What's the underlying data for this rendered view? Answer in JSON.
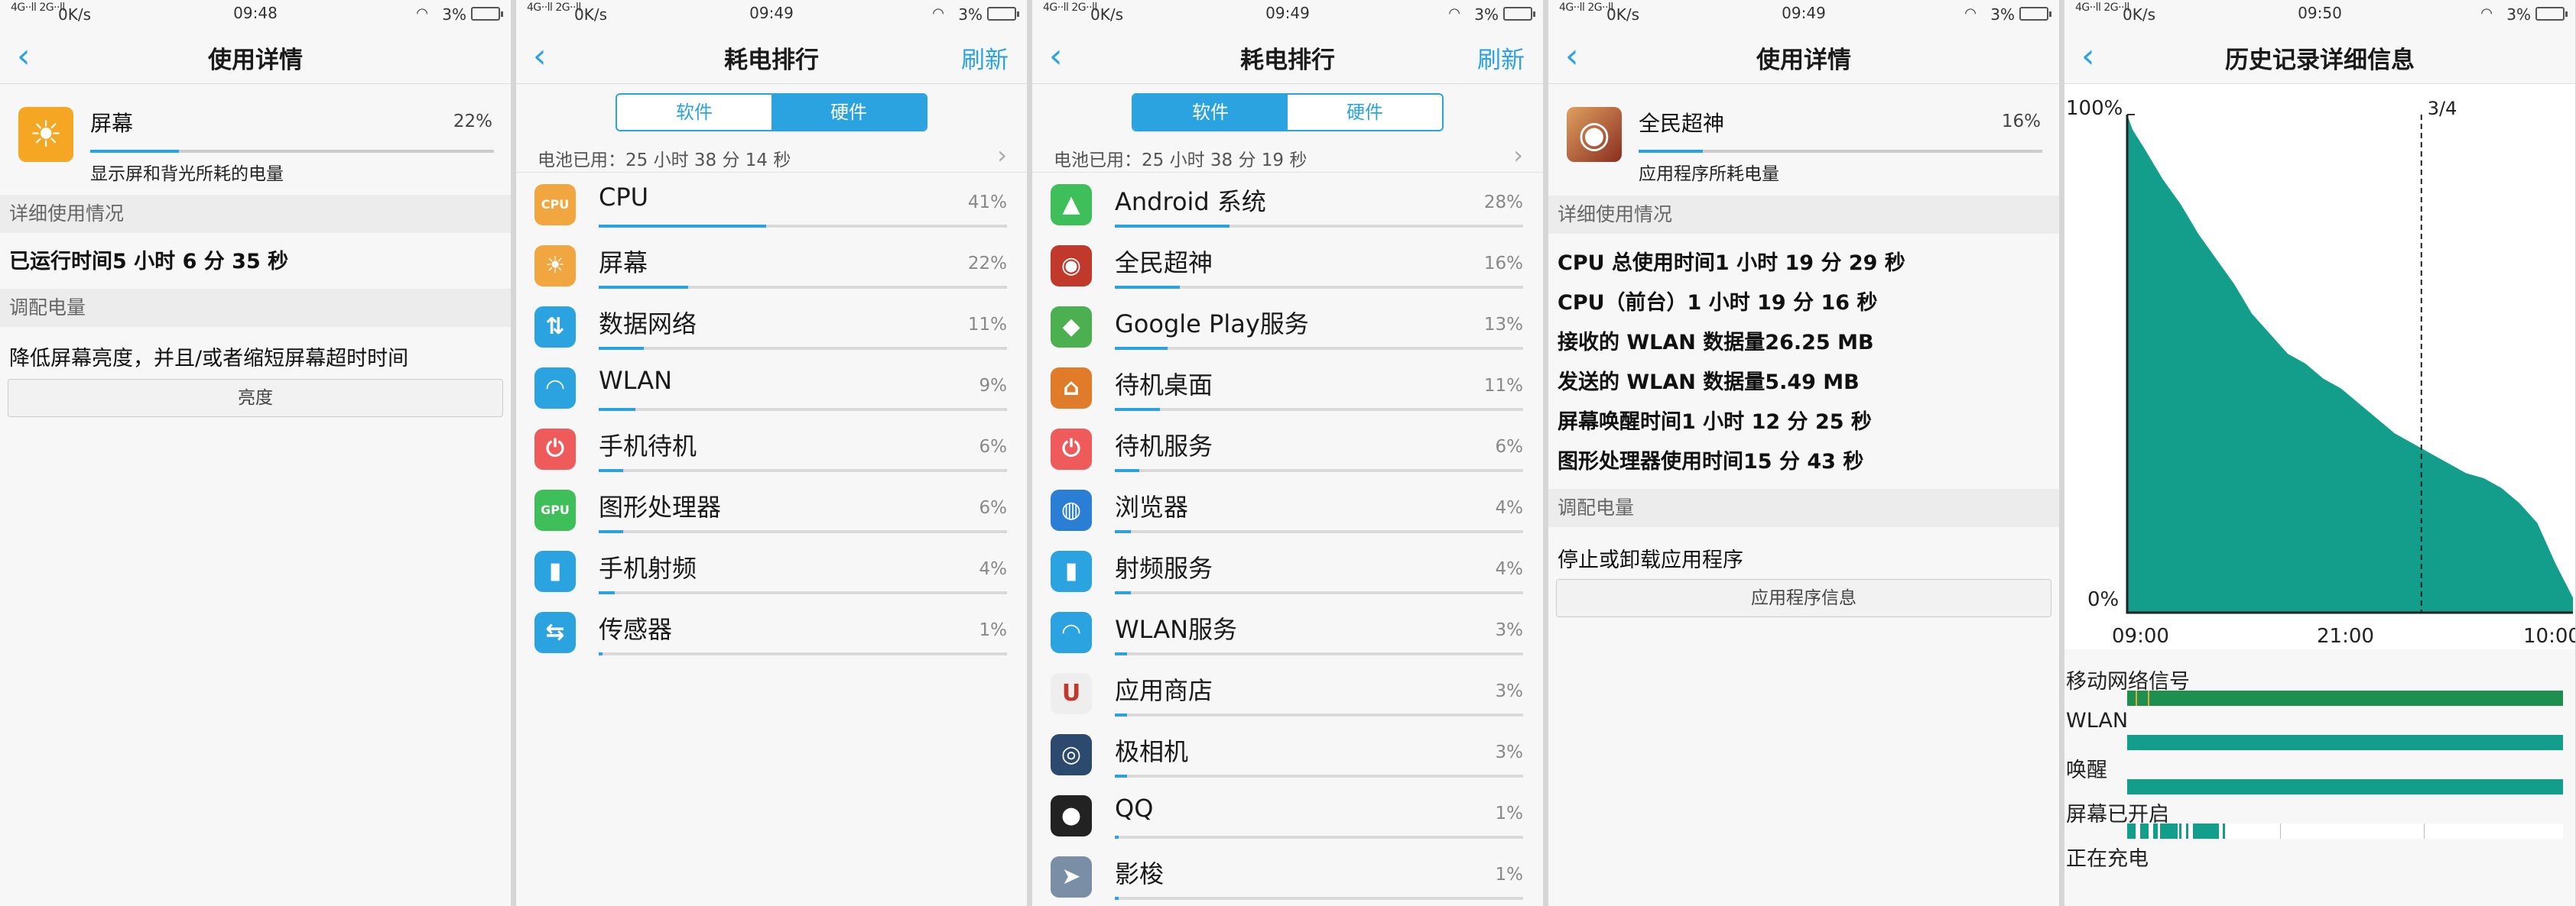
{
  "status": {
    "signal": "4G··ll 2G··ll",
    "speed": "0K/s",
    "wifi_icon": "wifi-icon",
    "battery_pct": "3%",
    "times": [
      "09:48",
      "09:49",
      "09:49",
      "09:49",
      "09:50"
    ]
  },
  "colors": {
    "accent": "#2aa3e0",
    "chart_fill": "#129e8a",
    "charge_orange": "#f2a640"
  },
  "screen1": {
    "title": "使用详情",
    "item_name": "屏幕",
    "item_pct": "22%",
    "item_fraction": 0.22,
    "item_sub": "显示屏和背光所耗的电量",
    "sec_detail": "详细使用情况",
    "runtime": "已运行时间5 小时 6 分 35 秒",
    "sec_adjust": "调配电量",
    "tip": "降低屏幕亮度，并且/或者缩短屏幕超时时间",
    "button": "亮度"
  },
  "screen2": {
    "title": "耗电排行",
    "refresh": "刷新",
    "tab_software": "软件",
    "tab_hardware": "硬件",
    "battery_used": "电池已用：25 小时 38 分 14 秒",
    "rows": [
      {
        "label": "CPU",
        "pct": "41%",
        "value": 41,
        "icon": "cpu-icon",
        "glyph": "CPU",
        "color": "#f2a640"
      },
      {
        "label": "屏幕",
        "pct": "22%",
        "value": 22,
        "icon": "sun-icon",
        "glyph": "☀",
        "color": "#f2a640"
      },
      {
        "label": "数据网络",
        "pct": "11%",
        "value": 11,
        "icon": "data-network-icon",
        "glyph": "⇅",
        "color": "#2aa3e0"
      },
      {
        "label": "WLAN",
        "pct": "9%",
        "value": 9,
        "icon": "wifi-icon",
        "glyph": "◠",
        "color": "#2aa3e0"
      },
      {
        "label": "手机待机",
        "pct": "6%",
        "value": 6,
        "icon": "power-icon",
        "glyph": "⏻",
        "color": "#ef5b5b"
      },
      {
        "label": "图形处理器",
        "pct": "6%",
        "value": 6,
        "icon": "gpu-icon",
        "glyph": "GPU",
        "color": "#3fbf5a"
      },
      {
        "label": "手机射频",
        "pct": "4%",
        "value": 4,
        "icon": "signal-bars-icon",
        "glyph": "▮",
        "color": "#2aa3e0"
      },
      {
        "label": "传感器",
        "pct": "1%",
        "value": 1,
        "icon": "sensor-icon",
        "glyph": "⇆",
        "color": "#2aa3e0"
      }
    ]
  },
  "screen3": {
    "title": "耗电排行",
    "refresh": "刷新",
    "tab_software": "软件",
    "tab_hardware": "硬件",
    "battery_used": "电池已用：25 小时 38 分 19 秒",
    "rows": [
      {
        "label": "Android 系统",
        "pct": "28%",
        "value": 28,
        "icon": "android-icon",
        "glyph": "▲",
        "color": "#3fbf5a"
      },
      {
        "label": "全民超神",
        "pct": "16%",
        "value": 16,
        "icon": "game-app-icon",
        "glyph": "◉",
        "color": "#c0392b"
      },
      {
        "label": "Google Play服务",
        "pct": "13%",
        "value": 13,
        "icon": "google-play-services-icon",
        "glyph": "◆",
        "color": "#4caf50"
      },
      {
        "label": "待机桌面",
        "pct": "11%",
        "value": 11,
        "icon": "home-icon",
        "glyph": "⌂",
        "color": "#e07b2a"
      },
      {
        "label": "待机服务",
        "pct": "6%",
        "value": 6,
        "icon": "power-icon",
        "glyph": "⏻",
        "color": "#ef5b5b"
      },
      {
        "label": "浏览器",
        "pct": "4%",
        "value": 4,
        "icon": "globe-icon",
        "glyph": "◍",
        "color": "#2a7fd4"
      },
      {
        "label": "射频服务",
        "pct": "4%",
        "value": 4,
        "icon": "signal-bars-icon",
        "glyph": "▮",
        "color": "#2aa3e0"
      },
      {
        "label": "WLAN服务",
        "pct": "3%",
        "value": 3,
        "icon": "wifi-icon",
        "glyph": "◠",
        "color": "#2aa3e0"
      },
      {
        "label": "应用商店",
        "pct": "3%",
        "value": 3,
        "icon": "app-store-icon",
        "glyph": "U",
        "color": "#eeeeee"
      },
      {
        "label": "极相机",
        "pct": "3%",
        "value": 3,
        "icon": "camera-icon",
        "glyph": "◎",
        "color": "#2b4a6e"
      },
      {
        "label": "QQ",
        "pct": "1%",
        "value": 1,
        "icon": "qq-penguin-icon",
        "glyph": "●",
        "color": "#222222"
      },
      {
        "label": "影梭",
        "pct": "1%",
        "value": 1,
        "icon": "paper-plane-icon",
        "glyph": "➤",
        "color": "#7a8fa6"
      }
    ]
  },
  "screen4": {
    "title": "使用详情",
    "app_name": "全民超神",
    "app_pct": "16%",
    "app_fraction": 0.16,
    "app_sub": "应用程序所耗电量",
    "sec_detail": "详细使用情况",
    "stats": [
      "CPU 总使用时间1 小时 19 分 29 秒",
      "CPU（前台）1 小时 19 分 16 秒",
      "接收的 WLAN 数据量26.25 MB",
      "发送的 WLAN 数据量5.49 MB",
      "屏幕唤醒时间1 小时 12 分 25 秒",
      "图形处理器使用时间15 分 43 秒"
    ],
    "sec_adjust": "调配电量",
    "tip": "停止或卸载应用程序",
    "button": "应用程序信息"
  },
  "screen5": {
    "title": "历史记录详细信息",
    "y_top": "100%",
    "y_bottom": "0%",
    "marker": "3/4",
    "x_labels": [
      "09:00",
      "21:00",
      "10:00"
    ],
    "tracks": [
      "移动网络信号",
      "WLAN",
      "唤醒",
      "屏幕已开启",
      "正在充电"
    ]
  },
  "chart_data": {
    "type": "area",
    "ylabel": "",
    "ylim": [
      0,
      100
    ],
    "xticks": [
      "09:00",
      "21:00",
      "10:00"
    ],
    "x_hours": [
      0,
      0.3,
      1,
      2,
      3,
      4,
      5,
      6,
      7,
      8,
      9,
      10,
      11,
      12,
      13,
      14,
      15,
      16,
      17,
      18,
      19,
      20,
      21,
      22,
      23,
      24,
      25
    ],
    "battery_pct": [
      100,
      97,
      93,
      87,
      82,
      76,
      71,
      66,
      60,
      56,
      52,
      50,
      47,
      45,
      42,
      39,
      36,
      34,
      32,
      30,
      28,
      27,
      25,
      22,
      18,
      10,
      3
    ],
    "marker_x_hour": 16.5
  }
}
